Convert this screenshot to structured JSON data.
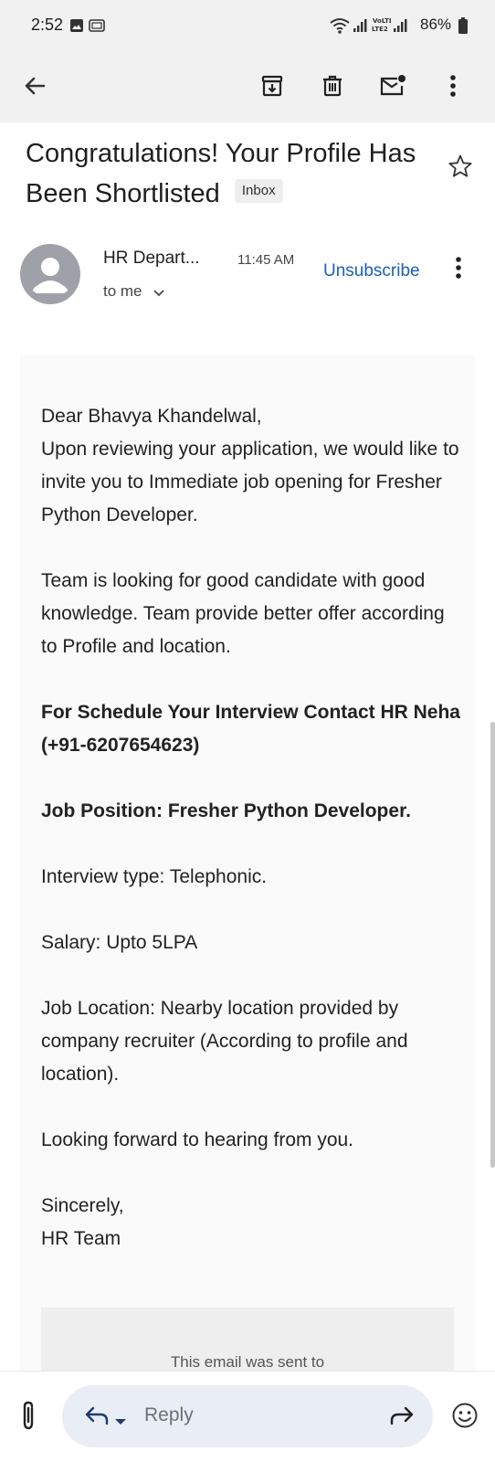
{
  "status_bar": {
    "time": "2:52",
    "battery": "86%",
    "network": "VoLTE2"
  },
  "toolbar": {
    "icons": [
      "back-arrow-icon",
      "archive-icon",
      "delete-icon",
      "mark-unread-icon",
      "more-vert-icon"
    ]
  },
  "email": {
    "subject": "Congratulations! Your Profile Has Been Shortlisted",
    "label": "Inbox",
    "sender": "HR Depart...",
    "time": "11:45 AM",
    "unsubscribe": "Unsubscribe",
    "recipient": "to me",
    "body": {
      "greeting": "Dear Bhavya Khandelwal,",
      "intro": "Upon reviewing your application, we would like to invite you to Immediate job opening for Fresher Python Developer.",
      "team": "Team is looking for good candidate with good knowledge. Team provide better offer according to Profile and location.",
      "schedule": "For Schedule Your Interview Contact HR Neha (+91-6207654623)",
      "position": "Job Position: Fresher Python Developer.",
      "interview_type": "Interview type: Telephonic.",
      "salary": "Salary: Upto 5LPA",
      "location": "Job Location: Nearby location provided by company recruiter (According to profile and location).",
      "closing": "Looking forward to hearing from you.",
      "signoff": "Sincerely,",
      "signature": "HR Team"
    },
    "footer": "This email was sent to"
  },
  "bottom_bar": {
    "reply_label": "Reply"
  },
  "colors": {
    "accent_link": "#1a5fb4",
    "reply_pill": "#e8edf6",
    "toolbar_bg": "#f1f1f1"
  }
}
